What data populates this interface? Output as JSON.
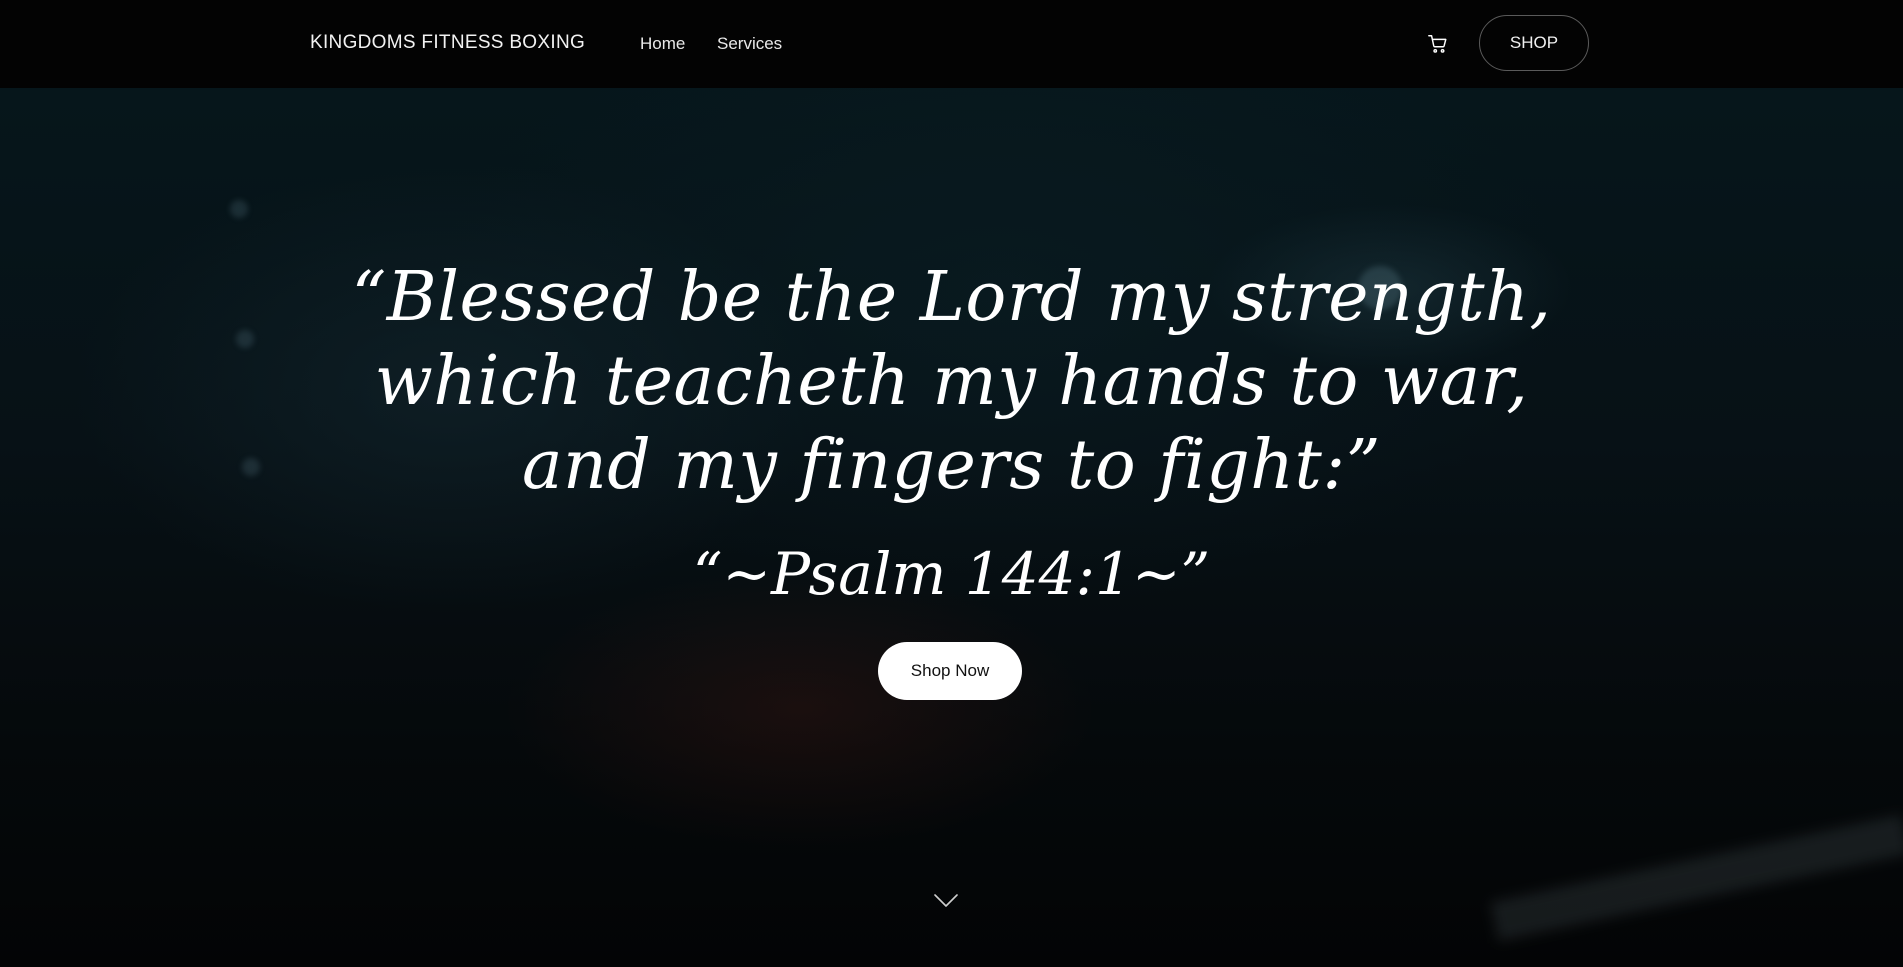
{
  "header": {
    "brand": "KINGDOMS FITNESS BOXING",
    "nav": [
      {
        "label": "Home"
      },
      {
        "label": "Services"
      }
    ],
    "cart_icon": "cart-icon",
    "shop_label": "SHOP"
  },
  "hero": {
    "quote_lines": [
      "“Blessed be the Lord my strength,",
      "which teacheth my hands to war,",
      "and my fingers to fight:”"
    ],
    "attribution": "“~Psalm 144:1~”",
    "cta_label": "Shop Now",
    "scroll_icon": "chevron-down-icon"
  },
  "colors": {
    "header_bg": "#030303",
    "text": "#ffffff",
    "cta_bg": "#ffffff",
    "cta_text": "#111111"
  }
}
